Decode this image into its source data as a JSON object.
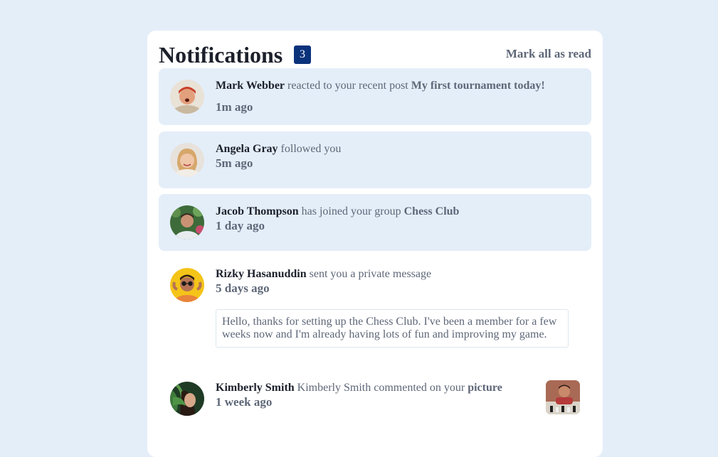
{
  "header": {
    "title": "Notifications",
    "badge_count": "3",
    "mark_all_label": "Mark all as read"
  },
  "notifications": [
    {
      "name": "Mark Webber",
      "action": " reacted to your recent post ",
      "target": "My first tournament today!",
      "time": "1m ago",
      "unread": true
    },
    {
      "name": "Angela Gray",
      "action": " followed you",
      "target": "",
      "time": "5m ago",
      "unread": true
    },
    {
      "name": "Jacob Thompson",
      "action": " has joined your group ",
      "target": "Chess Club",
      "time": "1 day ago",
      "unread": true
    },
    {
      "name": "Rizky Hasanuddin",
      "action": " sent you a private message",
      "target": "",
      "time": "5 days ago",
      "message": "Hello, thanks for setting up the Chess Club. I've been a member for a few weeks now and I'm already having lots of fun and improving my game.",
      "unread": false
    },
    {
      "name": "Kimberly Smith",
      "action": " Kimberly Smith commented on your ",
      "target": "picture",
      "time": "1 week ago",
      "unread": false
    }
  ]
}
